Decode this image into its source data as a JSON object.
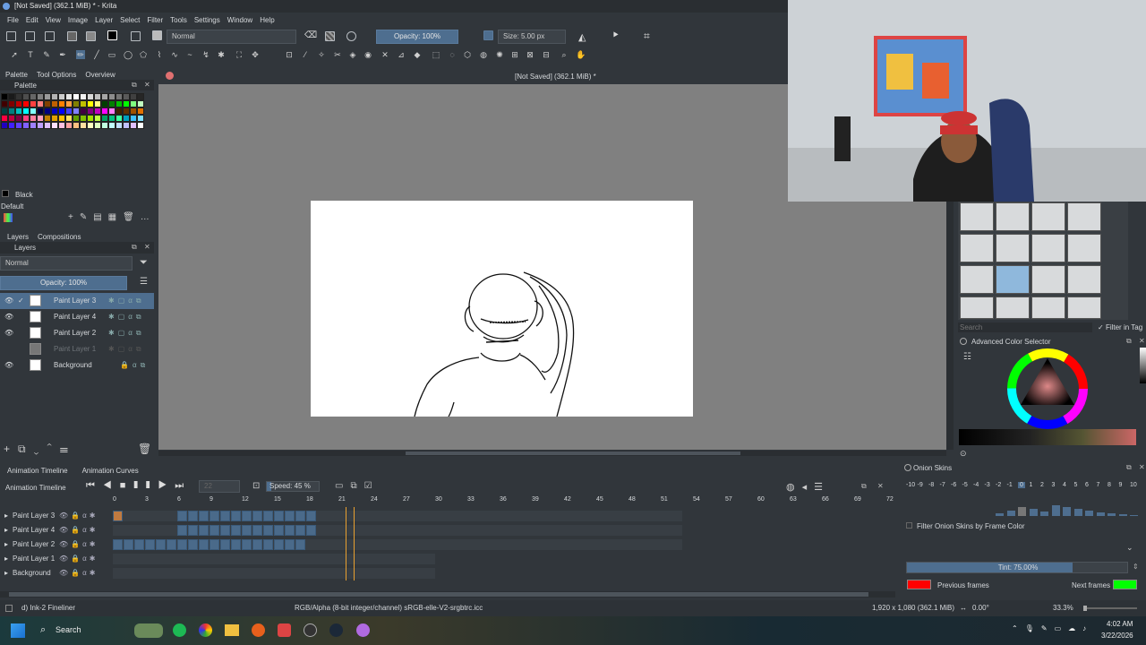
{
  "window": {
    "title": "[Not Saved]  (362.1 MiB)  * - Krita"
  },
  "menu": [
    "File",
    "Edit",
    "View",
    "Image",
    "Layer",
    "Select",
    "Filter",
    "Tools",
    "Settings",
    "Window",
    "Help"
  ],
  "toolbar": {
    "blend_mode": "Normal",
    "opacity_label": "Opacity: 100%",
    "size_label": "Size: 5.00 px"
  },
  "left_tabs": [
    "Palette",
    "Tool Options",
    "Overview"
  ],
  "palette": {
    "title": "Palette",
    "current_color_name": "Black",
    "palette_name": "Default",
    "colors": [
      "#000000",
      "#1a1a1a",
      "#333333",
      "#4d4d4d",
      "#666666",
      "#808080",
      "#999999",
      "#b3b3b3",
      "#cccccc",
      "#e6e6e6",
      "#ffffff",
      "#f2f2f2",
      "#d9d9d9",
      "#bfbfbf",
      "#a6a6a6",
      "#8c8c8c",
      "#737373",
      "#595959",
      "#404040",
      "#262626",
      "#400000",
      "#800000",
      "#c00000",
      "#ff0000",
      "#ff4040",
      "#ff8080",
      "#804000",
      "#c06000",
      "#ff8000",
      "#ffa040",
      "#808000",
      "#c0c000",
      "#ffff00",
      "#ffff80",
      "#004000",
      "#008000",
      "#00c000",
      "#00ff00",
      "#80ff80",
      "#c0ffc0",
      "#004040",
      "#008080",
      "#00c0c0",
      "#00ffff",
      "#80ffff",
      "#000040",
      "#000080",
      "#0000c0",
      "#0000ff",
      "#4040ff",
      "#8080ff",
      "#400040",
      "#800080",
      "#c000c0",
      "#ff00ff",
      "#ff80ff",
      "#402000",
      "#603000",
      "#a05000",
      "#e07000",
      "#ff0040",
      "#c00040",
      "#800040",
      "#ff4080",
      "#ff80a0",
      "#ffa0c0",
      "#c08000",
      "#e0a000",
      "#ffc000",
      "#ffe060",
      "#60a000",
      "#80c000",
      "#a0e000",
      "#c0ff40",
      "#00a060",
      "#00c080",
      "#40ffa0",
      "#00a0c0",
      "#40c0ff",
      "#80e0ff",
      "#2000c0",
      "#4020ff",
      "#6040ff",
      "#8060ff",
      "#a080ff",
      "#c0a0ff",
      "#e0c0ff",
      "#ffe0ff",
      "#ffc0e0",
      "#ffa0a0",
      "#ffc080",
      "#ffe0a0",
      "#ffffc0",
      "#e0ffc0",
      "#c0ffe0",
      "#c0ffff",
      "#c0e0ff",
      "#c0c0ff",
      "#e0c0ff",
      "#ffffff"
    ]
  },
  "layers_panel": {
    "tabs": [
      "Layers",
      "Compositions"
    ],
    "blend_mode": "Normal",
    "opacity_label": "Opacity:  100%",
    "layers": [
      {
        "name": "Paint Layer 3",
        "selected": true,
        "dim": false
      },
      {
        "name": "Paint Layer 4",
        "selected": false,
        "dim": false
      },
      {
        "name": "Paint Layer 2",
        "selected": false,
        "dim": false
      },
      {
        "name": "Paint Layer 1",
        "selected": false,
        "dim": true
      },
      {
        "name": "Background",
        "selected": false,
        "dim": false
      }
    ]
  },
  "document_tab": "[Not Saved]  (362.1 MiB) *",
  "brushes_panel": {
    "search_placeholder": "Search",
    "filter_label": "Filter in Tag"
  },
  "color_selector": {
    "title": "Advanced Color Selector"
  },
  "timeline": {
    "tabs": [
      "Animation Timeline",
      "Animation Curves"
    ],
    "title": "Animation Timeline",
    "frame_field": "22",
    "speed_label": "Speed: 45 %",
    "ruler": [
      "0",
      "3",
      "6",
      "9",
      "12",
      "15",
      "18",
      "21",
      "24",
      "27",
      "30",
      "33",
      "36",
      "39",
      "42",
      "45",
      "48",
      "51",
      "54",
      "57",
      "60",
      "63",
      "66",
      "69",
      "72"
    ],
    "layers": [
      "Paint Layer 3",
      "Paint Layer 4",
      "Paint Layer 2",
      "Paint Layer 1",
      "Background"
    ],
    "current_frame": 22
  },
  "onion": {
    "title": "Onion Skins",
    "numbers": [
      "-10",
      "-9",
      "-8",
      "-7",
      "-6",
      "-5",
      "-4",
      "-3",
      "-2",
      "-1",
      "0",
      "1",
      "2",
      "3",
      "4",
      "5",
      "6",
      "7",
      "8",
      "9",
      "10"
    ],
    "filter_label": "Filter Onion Skins by Frame Color",
    "tint_label": "Tint: 75.00%",
    "tint_fraction": 0.75,
    "previous_label": "Previous frames",
    "next_label": "Next frames",
    "previous_color": "#ff0000",
    "next_color": "#00ff00"
  },
  "status": {
    "brush": "d) Ink-2 Fineliner",
    "color_profile": "RGB/Alpha (8-bit integer/channel)  sRGB-elle-V2-srgbtrc.icc",
    "dimensions": "1,920 x 1,080 (362.1 MiB)",
    "rotation": "0.00°",
    "zoom": "33.3%"
  },
  "taskbar": {
    "search_label": "Search",
    "time": "4:02 AM",
    "date": "3/22/2026"
  },
  "colors": {
    "accent": "#4e6e8f",
    "panel_bg": "#31363b",
    "playhead": "#e8a030"
  }
}
